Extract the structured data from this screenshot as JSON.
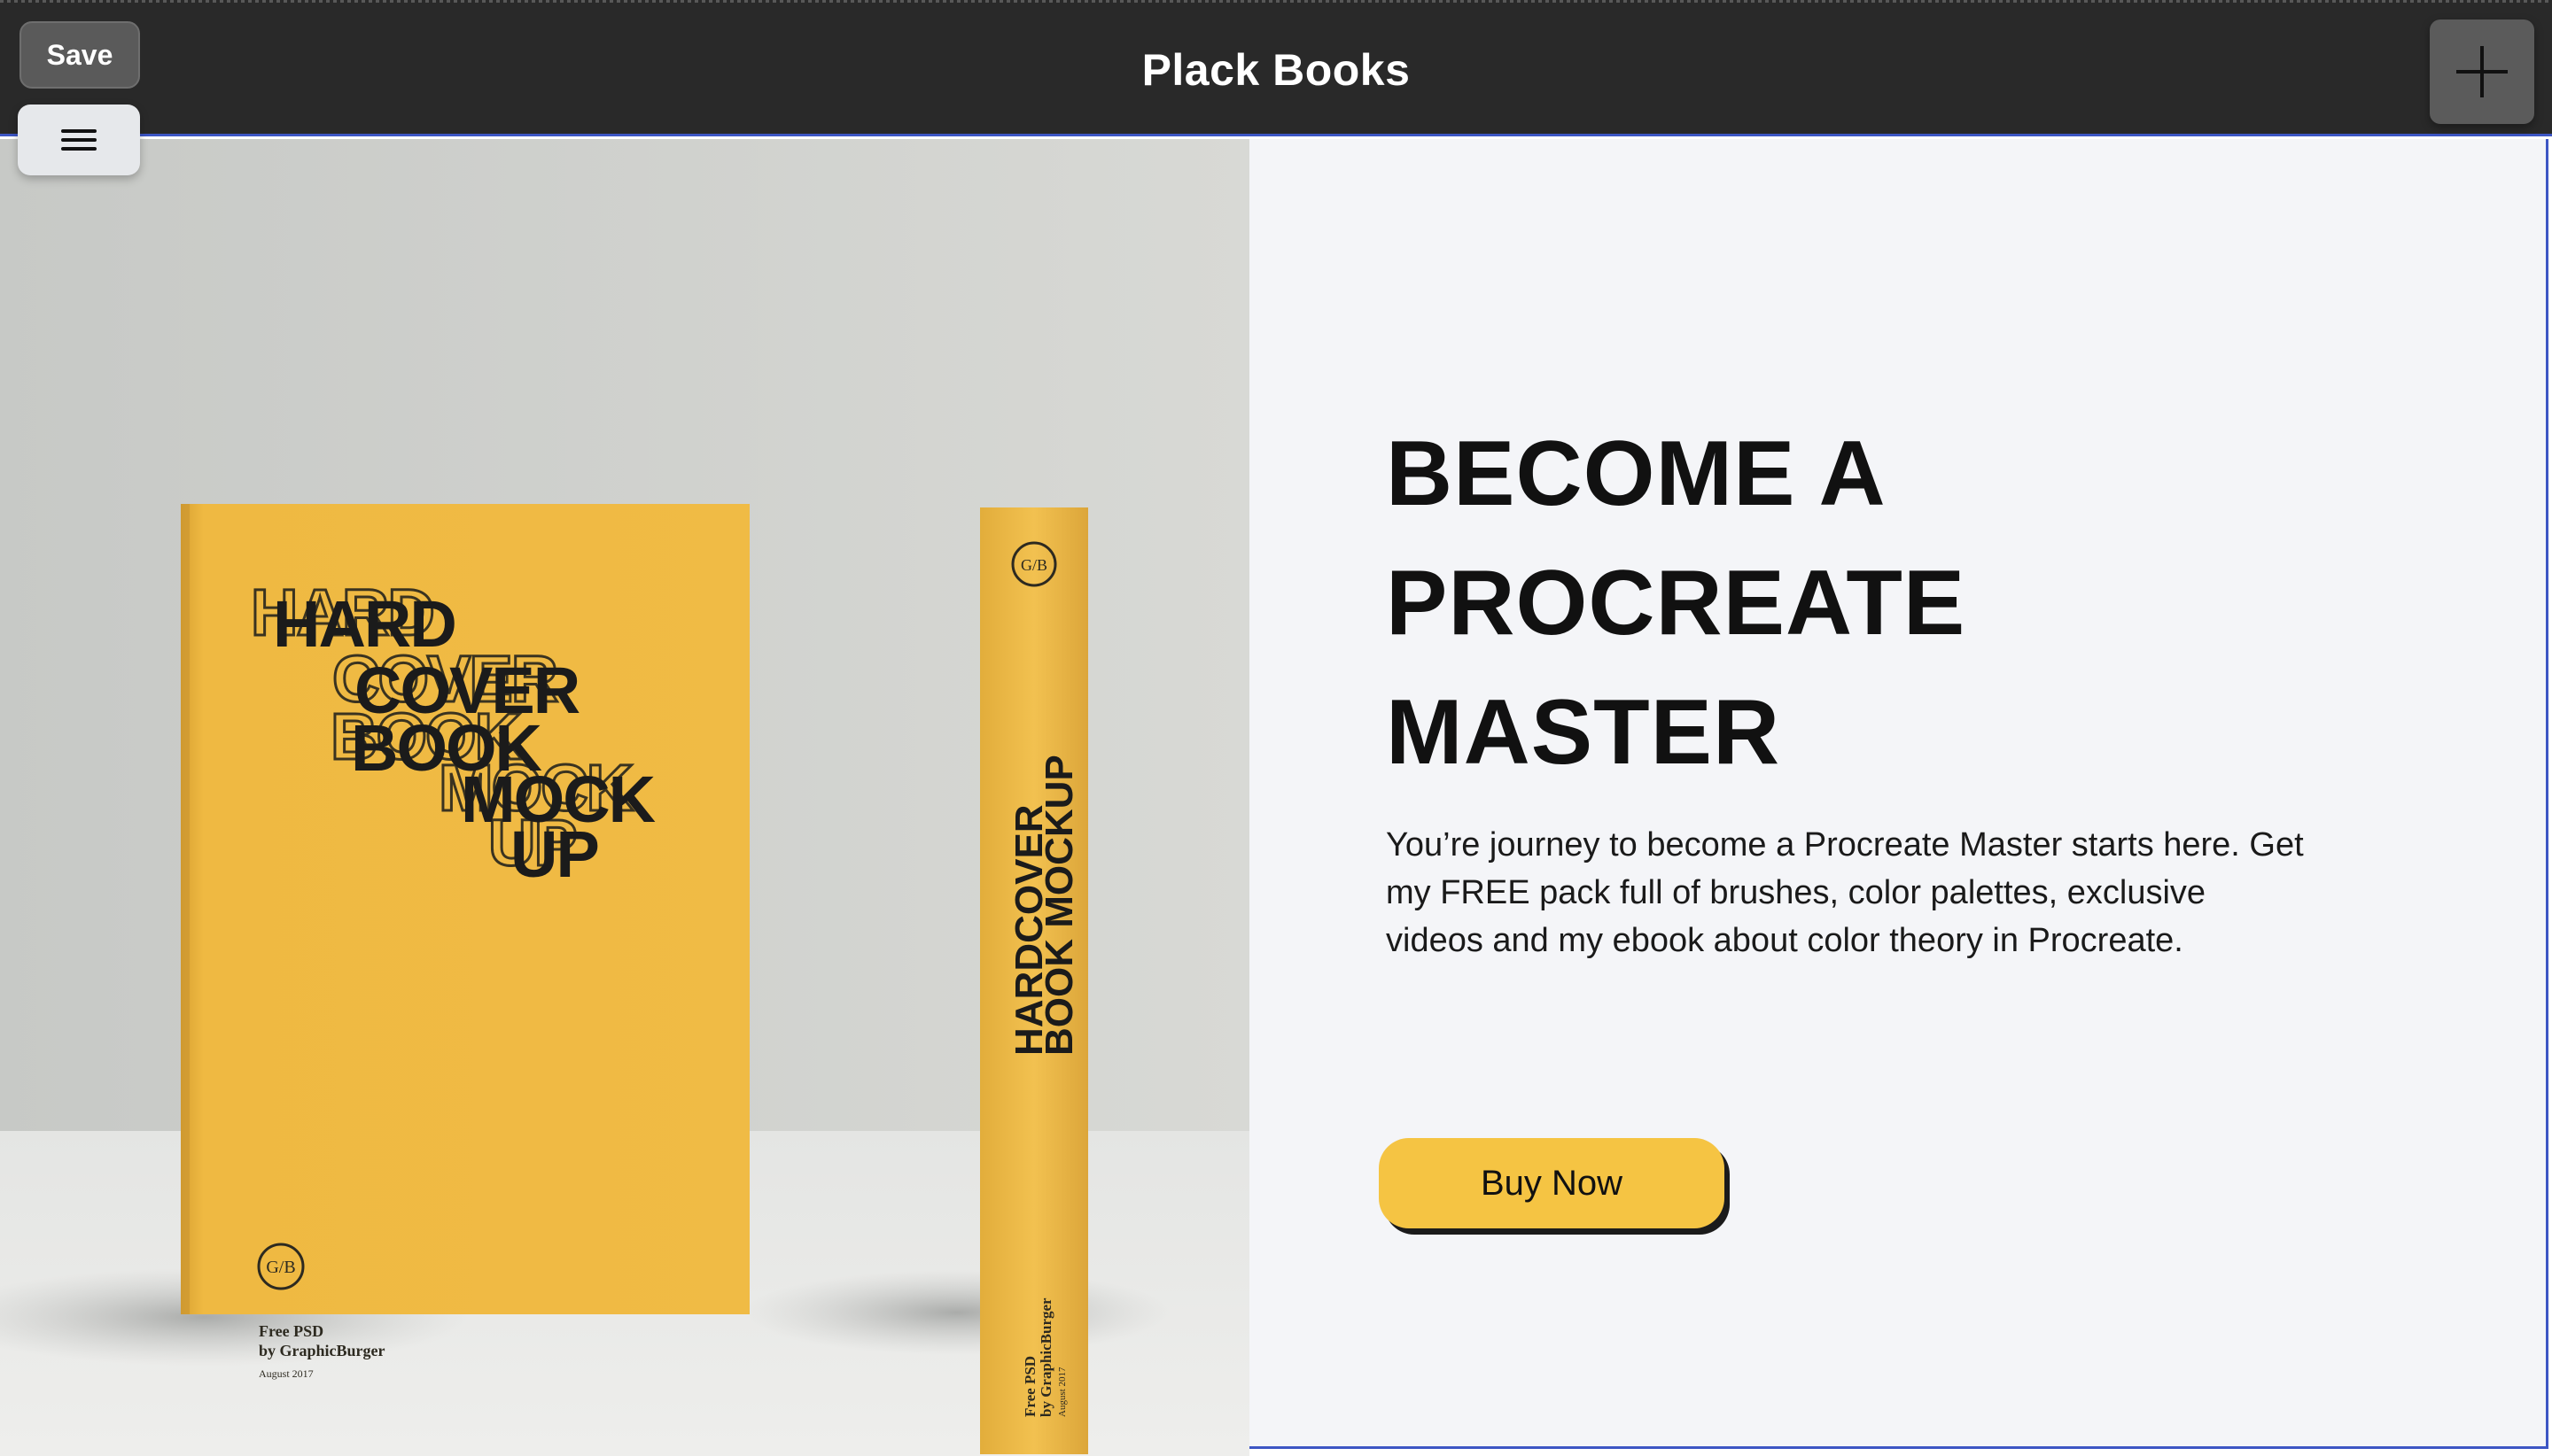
{
  "app": {
    "title": "Plack Books",
    "save_label": "Save"
  },
  "icons": {
    "menu": "hamburger-menu-icon",
    "add": "plus-icon"
  },
  "hero": {
    "image_alt": "Hardcover book mockup",
    "book_cover_lines": [
      "HARD",
      "COVER",
      "BOOK",
      "MOCK",
      "UP"
    ],
    "book_logo": "G/B",
    "book_credit_1": "Free PSD",
    "book_credit_2": "by GraphicBurger",
    "book_date": "August 2017",
    "spine_title_1": "HARDCOVER",
    "spine_title_2": "BOOK MOCKUP",
    "headline_lines": [
      "BECOME A",
      "PROCREATE",
      "MASTER"
    ],
    "description": "You’re journey to become a Procreate Master starts here. Get my FREE pack full of brushes, color palettes, exclusive videos and my ebook about color theory in Procreate.",
    "cta_label": "Buy Now"
  },
  "colors": {
    "topbar": "#292929",
    "accent_border": "#3d56c4",
    "book_yellow": "#f0b93f",
    "cta_yellow": "#f5c443",
    "panel_bg": "#f4f5f8"
  }
}
